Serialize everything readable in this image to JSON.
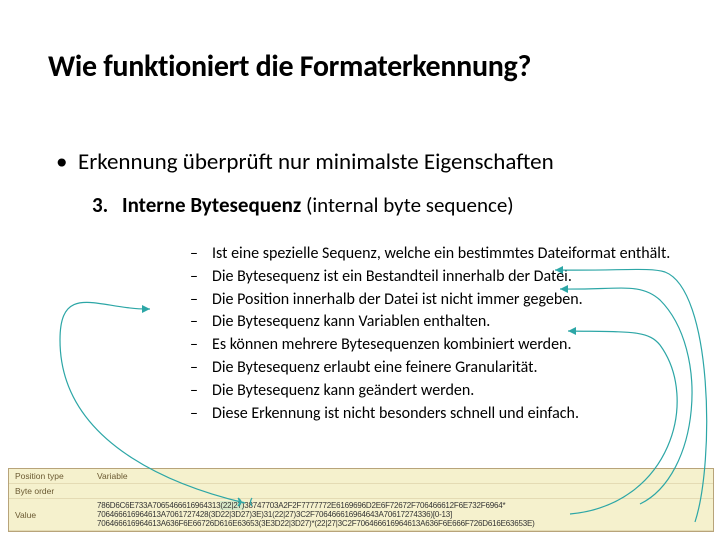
{
  "title": "Wie funktioniert die Formaterkennung?",
  "bullet1": "Erkennung überprüft nur minimalste Eigenschaften",
  "numbered": {
    "n": "3.",
    "label_strong": "Interne Bytesequenz",
    "label_rest": " (internal byte sequence)"
  },
  "dashes": [
    "Ist eine spezielle Sequenz, welche ein bestimmtes Dateiformat enthält.",
    "Die Bytesequenz ist ein Bestandteil innerhalb der Datei.",
    "Die Position innerhalb der Datei ist nicht immer gegeben.",
    "Die Bytesequenz kann Variablen enthalten.",
    "Es können mehrere Bytesequenzen kombiniert werden.",
    "Die Bytesequenz erlaubt eine feinere Granularität.",
    "Die Bytesequenz kann geändert werden.",
    "Diese Erkennung ist nicht besonders schnell und einfach."
  ],
  "table": {
    "headers": {
      "col1": "Position type",
      "col2": "Variable"
    },
    "rows": [
      {
        "label": "Byte order",
        "value": ""
      },
      {
        "label": "Value",
        "value_pre": "786D6C6E733A7065466616964313",
        "value_mark1": "(22|27)",
        "value_mid": "38747703A2F2F7777772E6169696D2E6F72672F706466612F6E732F6964*",
        "value_line2": "706466616964613A7061727428(3D22|3D27)3E)31(22|27)3C2F706466616964643A70617274336)[0-13]",
        "value_line3": "706466616964613A636F6E66726D616E63653(3E3D22|3D27)*(22|27|3C2F706466616964613A636F6E666F726D616E63653E)"
      }
    ]
  }
}
